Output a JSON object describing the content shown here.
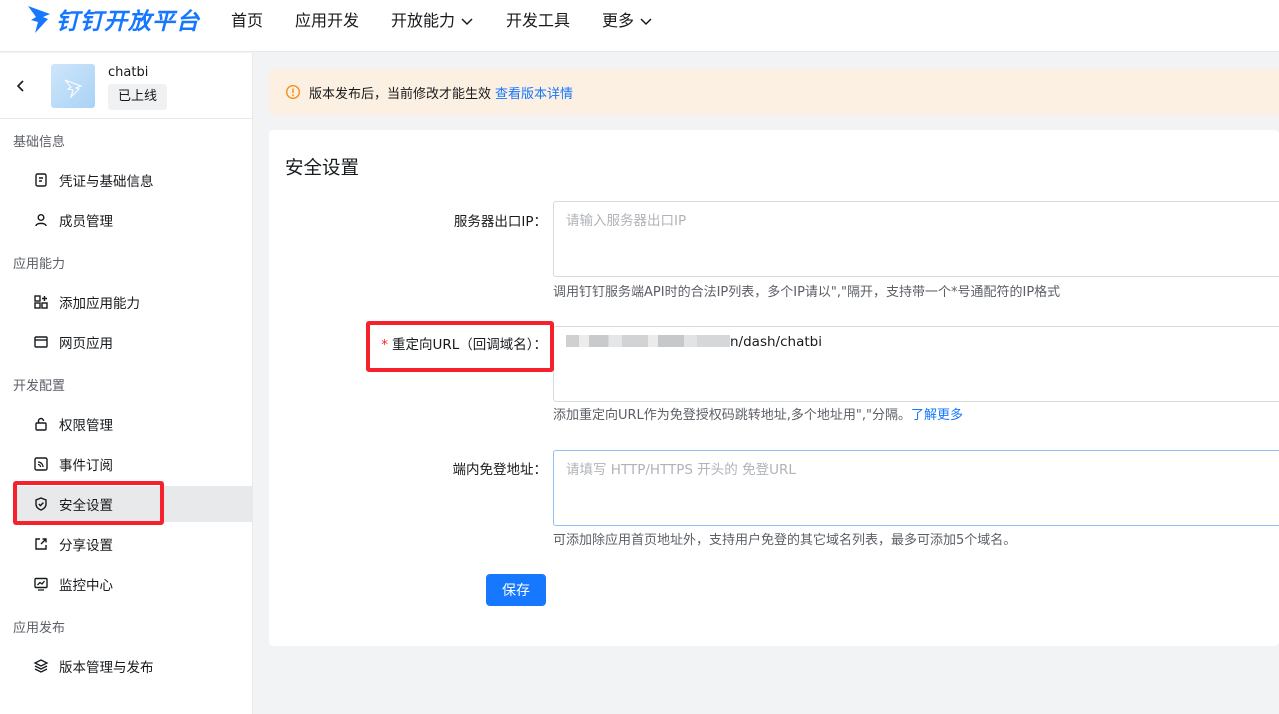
{
  "brand": {
    "name": "钉钉开放平台",
    "color": "#1677ff"
  },
  "topnav": {
    "items": [
      {
        "label": "首页",
        "dropdown": false
      },
      {
        "label": "应用开发",
        "dropdown": false
      },
      {
        "label": "开放能力",
        "dropdown": true
      },
      {
        "label": "开发工具",
        "dropdown": false
      },
      {
        "label": "更多",
        "dropdown": true
      }
    ]
  },
  "app": {
    "name": "chatbi",
    "status": "已上线"
  },
  "sidebar": {
    "groups": [
      {
        "title": "基础信息",
        "items": [
          {
            "label": "凭证与基础信息",
            "icon": "credential-icon"
          },
          {
            "label": "成员管理",
            "icon": "user-icon"
          }
        ]
      },
      {
        "title": "应用能力",
        "items": [
          {
            "label": "添加应用能力",
            "icon": "apps-add-icon"
          },
          {
            "label": "网页应用",
            "icon": "browser-icon"
          }
        ]
      },
      {
        "title": "开发配置",
        "items": [
          {
            "label": "权限管理",
            "icon": "lock-icon"
          },
          {
            "label": "事件订阅",
            "icon": "rss-icon"
          },
          {
            "label": "安全设置",
            "icon": "shield-icon",
            "active": true
          },
          {
            "label": "分享设置",
            "icon": "share-icon"
          },
          {
            "label": "监控中心",
            "icon": "monitor-icon"
          }
        ]
      },
      {
        "title": "应用发布",
        "items": [
          {
            "label": "版本管理与发布",
            "icon": "layers-icon"
          }
        ]
      }
    ]
  },
  "banner": {
    "text": "版本发布后，当前修改才能生效",
    "link": "查看版本详情"
  },
  "security": {
    "title": "安全设置",
    "server_ip": {
      "label": "服务器出口IP：",
      "placeholder": "请输入服务器出口IP",
      "help": "调用钉钉服务端API时的合法IP列表，多个IP请以\",\"隔开，支持带一个*号通配符的IP格式"
    },
    "redirect_url": {
      "required_mark": "*",
      "label": "重定向URL（回调域名）：",
      "value_suffix": "n/dash/chatbi",
      "help": "添加重定向URL作为免登授权码跳转地址,多个地址用\",\"分隔。",
      "help_link": "了解更多"
    },
    "sso_address": {
      "label": "端内免登地址：",
      "placeholder": "请填写 HTTP/HTTPS 开头的 免登URL",
      "help": "可添加除应用首页地址外，支持用户免登的其它域名列表，最多可添加5个域名。"
    },
    "save_label": "保存"
  },
  "colors": {
    "accent": "#1677ff",
    "highlight": "#f5222d",
    "banner_bg": "#fbf0e1",
    "warning_icon": "#fa8c16"
  }
}
